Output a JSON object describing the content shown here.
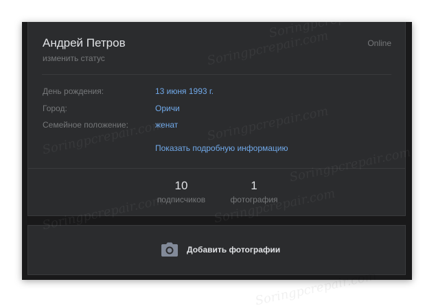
{
  "profile": {
    "name": "Андрей Петров",
    "status_link": "изменить статус",
    "online": "Online"
  },
  "info": [
    {
      "label": "День рождения:",
      "value": "13 июня 1993 г."
    },
    {
      "label": "Город:",
      "value": "Оричи"
    },
    {
      "label": "Семейное положение:",
      "value": "женат"
    }
  ],
  "more_link": "Показать подробную информацию",
  "counters": [
    {
      "num": "10",
      "label": "подписчиков"
    },
    {
      "num": "1",
      "label": "фотография"
    }
  ],
  "photos": {
    "add_label": "Добавить фотографии",
    "icon": "camera-icon"
  },
  "watermark": "Soringpcrepair.com",
  "colors": {
    "background": "#19191a",
    "card": "#2b2c2e",
    "link": "#71aaeb",
    "text": "#e1e3e6",
    "muted": "#76787a"
  }
}
